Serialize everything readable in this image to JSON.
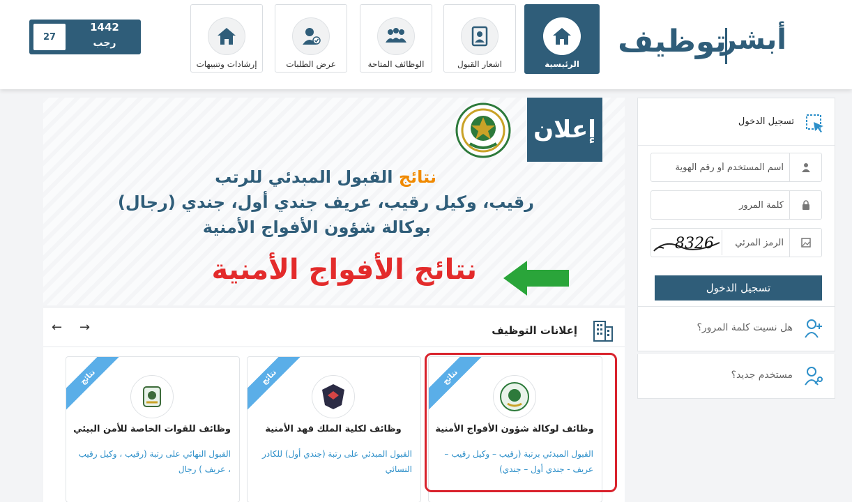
{
  "brand": {
    "logo_word_1": "أبشر",
    "logo_word_2": "توظيف"
  },
  "nav": {
    "items": [
      {
        "label": "الرئيسية",
        "icon": "home-icon",
        "active": true
      },
      {
        "label": "اشعار القبول",
        "icon": "badge-icon"
      },
      {
        "label": "الوظائف المتاحة",
        "icon": "group-icon"
      },
      {
        "label": "عرض الطلبات",
        "icon": "user-check-icon"
      },
      {
        "label": "إرشادات وتنبيهات",
        "icon": "home-icon"
      }
    ]
  },
  "date": {
    "day": "27",
    "year": "1442",
    "month": "رجب"
  },
  "banner": {
    "tag": "إعلان",
    "line1_highlight": "نتائج",
    "line1_rest": " القبول المبدئي للرتب",
    "line2": "رقيب، وكيل رقيب، عريف جندي أول، جندي (رجال)",
    "line3": "بوكالة شؤون الأفواج الأمنية",
    "red_text": "نتائج الأفواج الأمنية",
    "emblem_icon": "emblem-icon"
  },
  "jobs": {
    "title": "إعلانات التوظيف",
    "prev": "←",
    "next": "→",
    "cards": [
      {
        "ribbon": "نتائج",
        "title": "وظائف لوكالة شؤون الأفواج الأمنية",
        "desc": "القبول المبدئي برتبة (رقيب – وكيل رقيب – عريف - جندي أول – جندي)"
      },
      {
        "ribbon": "نتائج",
        "title": "وظائف لكلية الملك فهد الأمنية",
        "desc": "القبول المبدئي على رتبة (جندي أول) للكادر النسائي"
      },
      {
        "ribbon": "نتائج",
        "title": "وظائف للقوات الخاصة للأمن البيئي",
        "desc": "القبول النهائي على رتبة (رقيب ، وكيل رقيب ، عريف ) رجال"
      }
    ]
  },
  "login": {
    "title": "تسجيل الدخول",
    "username_placeholder": "اسم المستخدم أو رقم الهوية",
    "password_placeholder": "كلمة المرور",
    "captcha_placeholder": "الرمز المرئي",
    "captcha_text": "8326",
    "submit": "تسجيل الدخول",
    "forgot": "هل نسيت كلمة المرور؟",
    "new_user": "مستخدم جديد؟"
  },
  "colors": {
    "primary": "#2f5d79",
    "accent_orange": "#f08a00",
    "alert_red": "#e32b2b",
    "link_blue": "#2d8fc9",
    "ribbon_blue": "#5aaee8",
    "arrow_green": "#2aa53a"
  }
}
